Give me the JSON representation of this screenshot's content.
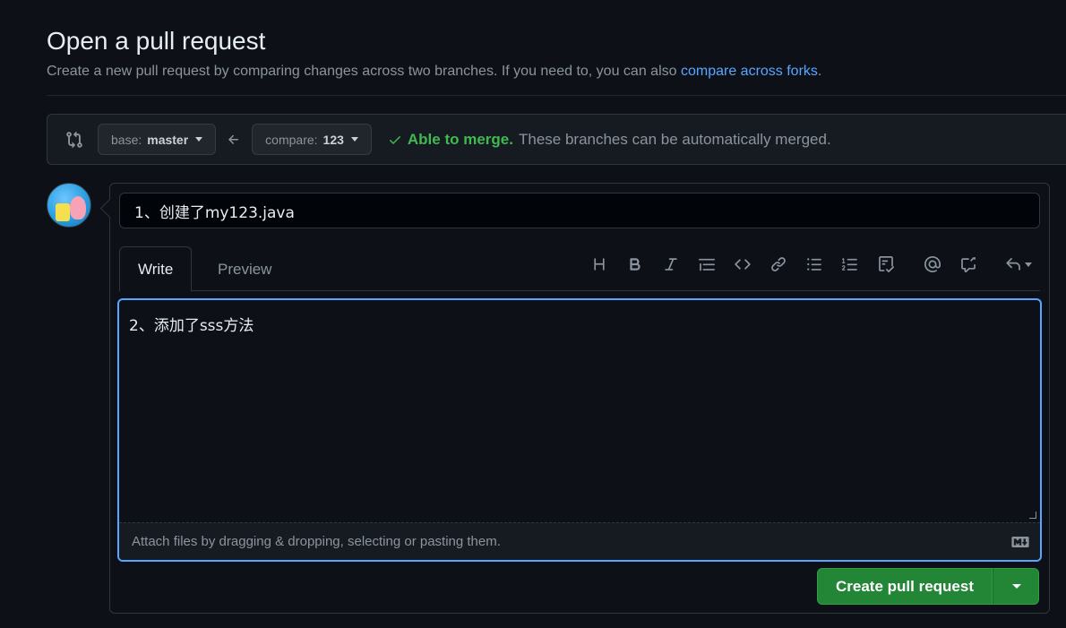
{
  "header": {
    "title": "Open a pull request",
    "subtitle": "Create a new pull request by comparing changes across two branches. If you need to, you can also ",
    "subtitle_link": "compare across forks",
    "subtitle_end": "."
  },
  "range": {
    "base_label": "base:",
    "base_value": "master",
    "compare_label": "compare:",
    "compare_value": "123",
    "merge_ok": "Able to merge.",
    "merge_msg": "These branches can be automatically merged."
  },
  "composer": {
    "title_value": "1、创建了my123.java",
    "tabs": [
      {
        "label": "Write"
      },
      {
        "label": "Preview"
      }
    ],
    "body_value": "2、添加了sss方法",
    "attach_text": "Attach files by dragging & dropping, selecting or pasting them.",
    "create_label": "Create pull request"
  },
  "toolbar_icons": [
    "heading-icon",
    "bold-icon",
    "italic-icon",
    "quote-icon",
    "code-icon",
    "link-icon",
    "bulleted-list-icon",
    "numbered-list-icon",
    "task-list-icon",
    "mention-icon",
    "cross-reference-icon",
    "reply-icon"
  ],
  "colors": {
    "background": "#0d1117",
    "accent": "#58a6ff",
    "success": "#3fb950",
    "button_green": "#238636"
  }
}
